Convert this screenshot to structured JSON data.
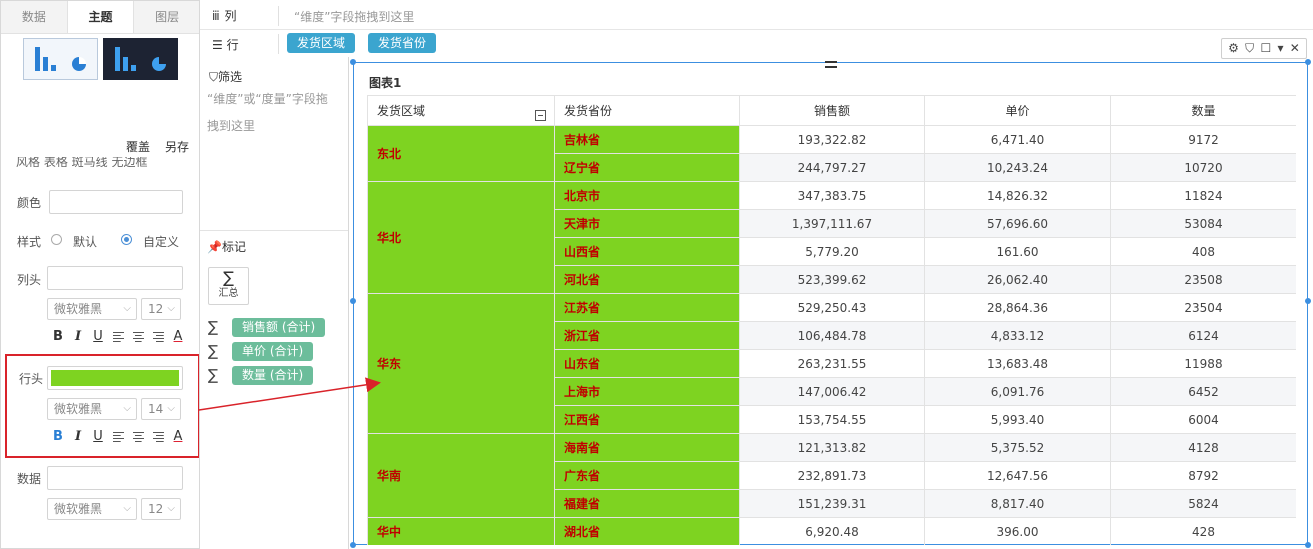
{
  "left_panel": {
    "tabs": [
      {
        "label": "数据"
      },
      {
        "label": "主题"
      },
      {
        "label": "图层"
      }
    ],
    "overwrite_label": "覆盖",
    "save_as_label": "另存",
    "style_row_partial": "风格  表格  斑马线  无边框",
    "color_label": "颜色",
    "style_label": "样式",
    "style_default": "默认",
    "style_custom": "自定义",
    "col_header_label": "列头",
    "row_header_label": "行头",
    "data_label": "数据",
    "font_family": "微软雅黑",
    "col_font_size": "12",
    "row_font_size": "14",
    "data_font_size": "12",
    "fmt_bold": "B",
    "fmt_italic": "I",
    "fmt_underline": "U",
    "fmt_color": "A",
    "row_header_color": "#7ed321",
    "highlight_color": "#d9232a"
  },
  "shelves": {
    "col_label": "列",
    "col_hint": "“维度”字段拖拽到这里",
    "row_label": "行",
    "row_pills": [
      "发货区域",
      "发货省份"
    ]
  },
  "mid_panel": {
    "filter_title": "筛选",
    "filter_hint": "“维度”或“度量”字段拖拽到这里",
    "mark_title": "标记",
    "sum_label": "汇总",
    "measures": [
      "销售额 (合计)",
      "单价 (合计)",
      "数量 (合计)"
    ]
  },
  "chart": {
    "title": "图表1",
    "headers": [
      "发货区域",
      "发货省份",
      "销售额",
      "单价",
      "数量"
    ],
    "regions": [
      {
        "name": "东北",
        "rows": [
          {
            "prov": "吉林省",
            "sales": "193,322.82",
            "price": "6,471.40",
            "qty": "9172"
          },
          {
            "prov": "辽宁省",
            "sales": "244,797.27",
            "price": "10,243.24",
            "qty": "10720"
          }
        ]
      },
      {
        "name": "华北",
        "rows": [
          {
            "prov": "北京市",
            "sales": "347,383.75",
            "price": "14,826.32",
            "qty": "11824"
          },
          {
            "prov": "天津市",
            "sales": "1,397,111.67",
            "price": "57,696.60",
            "qty": "53084"
          },
          {
            "prov": "山西省",
            "sales": "5,779.20",
            "price": "161.60",
            "qty": "408"
          },
          {
            "prov": "河北省",
            "sales": "523,399.62",
            "price": "26,062.40",
            "qty": "23508"
          }
        ]
      },
      {
        "name": "华东",
        "rows": [
          {
            "prov": "江苏省",
            "sales": "529,250.43",
            "price": "28,864.36",
            "qty": "23504"
          },
          {
            "prov": "浙江省",
            "sales": "106,484.78",
            "price": "4,833.12",
            "qty": "6124"
          },
          {
            "prov": "山东省",
            "sales": "263,231.55",
            "price": "13,683.48",
            "qty": "11988"
          },
          {
            "prov": "上海市",
            "sales": "147,006.42",
            "price": "6,091.76",
            "qty": "6452"
          },
          {
            "prov": "江西省",
            "sales": "153,754.55",
            "price": "5,993.40",
            "qty": "6004"
          }
        ]
      },
      {
        "name": "华南",
        "rows": [
          {
            "prov": "海南省",
            "sales": "121,313.82",
            "price": "5,375.52",
            "qty": "4128"
          },
          {
            "prov": "广东省",
            "sales": "232,891.73",
            "price": "12,647.56",
            "qty": "8792"
          },
          {
            "prov": "福建省",
            "sales": "151,239.31",
            "price": "8,817.40",
            "qty": "5824"
          }
        ]
      },
      {
        "name": "华中",
        "rows": [
          {
            "prov": "湖北省",
            "sales": "6,920.48",
            "price": "396.00",
            "qty": "428"
          }
        ]
      }
    ]
  }
}
